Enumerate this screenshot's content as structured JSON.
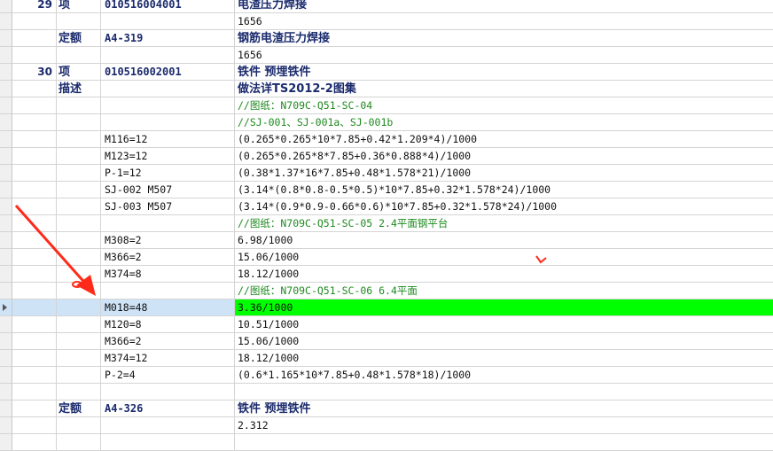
{
  "rows": [
    {
      "num": "29",
      "type": "项",
      "code": "010516004001",
      "attr": "",
      "expr": "电渣压力焊接",
      "kind": "item"
    },
    {
      "num": "",
      "type": "",
      "code": "",
      "attr": "",
      "expr": "1656",
      "kind": "value"
    },
    {
      "num": "",
      "type": "定额",
      "code": "A4-319",
      "attr": "",
      "expr": "钢筋电渣压力焊接",
      "kind": "item"
    },
    {
      "num": "",
      "type": "",
      "code": "",
      "attr": "",
      "expr": "1656",
      "kind": "value"
    },
    {
      "num": "30",
      "type": "项",
      "code": "010516002001",
      "attr": "",
      "expr": "铁件 预埋铁件",
      "kind": "item"
    },
    {
      "num": "",
      "type": "描述",
      "code": "",
      "attr": "",
      "expr": "做法详TS2012-2图集",
      "kind": "item"
    },
    {
      "num": "",
      "type": "",
      "code": "",
      "attr": "",
      "expr": "//图纸：N709C-Q51-SC-04",
      "kind": "comment"
    },
    {
      "num": "",
      "type": "",
      "code": "",
      "attr": "",
      "expr": "//SJ-001、SJ-001a、SJ-001b",
      "kind": "comment"
    },
    {
      "num": "",
      "type": "",
      "code": "",
      "attr": "M116=12",
      "expr": "(0.265*0.265*10*7.85+0.42*1.209*4)/1000",
      "kind": "value"
    },
    {
      "num": "",
      "type": "",
      "code": "",
      "attr": "M123=12",
      "expr": "(0.265*0.265*8*7.85+0.36*0.888*4)/1000",
      "kind": "value"
    },
    {
      "num": "",
      "type": "",
      "code": "",
      "attr": "P-1=12",
      "expr": "(0.38*1.37*16*7.85+0.48*1.578*21)/1000",
      "kind": "value"
    },
    {
      "num": "",
      "type": "",
      "code": "",
      "attr": "SJ-002 M507",
      "expr": "(3.14*(0.8*0.8-0.5*0.5)*10*7.85+0.32*1.578*24)/1000",
      "kind": "value"
    },
    {
      "num": "",
      "type": "",
      "code": "",
      "attr": "SJ-003 M507",
      "expr": "(3.14*(0.9*0.9-0.66*0.6)*10*7.85+0.32*1.578*24)/1000",
      "kind": "value"
    },
    {
      "num": "",
      "type": "",
      "code": "",
      "attr": "",
      "expr": "//图纸：N709C-Q51-SC-05 2.4平面钢平台",
      "kind": "comment"
    },
    {
      "num": "",
      "type": "",
      "code": "",
      "attr": "M308=2",
      "expr": "6.98/1000",
      "kind": "value"
    },
    {
      "num": "",
      "type": "",
      "code": "",
      "attr": "M366=2",
      "expr": "15.06/1000",
      "kind": "value"
    },
    {
      "num": "",
      "type": "",
      "code": "",
      "attr": "M374=8",
      "expr": "18.12/1000",
      "kind": "value"
    },
    {
      "num": "",
      "type": "",
      "code": "",
      "attr": "",
      "expr": "//图纸：N709C-Q51-SC-06 6.4平面",
      "kind": "comment"
    },
    {
      "num": "",
      "type": "",
      "code": "",
      "attr": "M018=48",
      "expr": "3.36/1000",
      "kind": "value",
      "selected": true
    },
    {
      "num": "",
      "type": "",
      "code": "",
      "attr": "M120=8",
      "expr": "10.51/1000",
      "kind": "value"
    },
    {
      "num": "",
      "type": "",
      "code": "",
      "attr": "M366=2",
      "expr": "15.06/1000",
      "kind": "value"
    },
    {
      "num": "",
      "type": "",
      "code": "",
      "attr": "M374=12",
      "expr": "18.12/1000",
      "kind": "value"
    },
    {
      "num": "",
      "type": "",
      "code": "",
      "attr": "P-2=4",
      "expr": "(0.6*1.165*10*7.85+0.48*1.578*18)/1000",
      "kind": "value"
    },
    {
      "num": "",
      "type": "",
      "code": "",
      "attr": "",
      "expr": "",
      "kind": "value"
    },
    {
      "num": "",
      "type": "定额",
      "code": "A4-326",
      "attr": "",
      "expr": "铁件 预埋铁件",
      "kind": "item"
    },
    {
      "num": "",
      "type": "",
      "code": "",
      "attr": "",
      "expr": "2.312",
      "kind": "value"
    },
    {
      "num": "",
      "type": "",
      "code": "",
      "attr": "",
      "expr": "",
      "kind": "value"
    }
  ],
  "colors": {
    "selected_highlight": "#00ff00",
    "annotation": "#ff2a1a",
    "comment_text": "#1f8a1f"
  }
}
